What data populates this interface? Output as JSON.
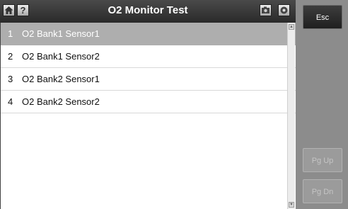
{
  "header": {
    "title": "O2 Monitor Test",
    "help_label": "?",
    "icons": [
      "home-icon",
      "help-icon",
      "camera-icon",
      "record-icon"
    ]
  },
  "list": {
    "items": [
      {
        "num": "1",
        "label": "O2 Bank1 Sensor1",
        "selected": true
      },
      {
        "num": "2",
        "label": "O2 Bank1 Sensor2",
        "selected": false
      },
      {
        "num": "3",
        "label": "O2 Bank2 Sensor1",
        "selected": false
      },
      {
        "num": "4",
        "label": "O2 Bank2 Sensor2",
        "selected": false
      }
    ]
  },
  "side": {
    "esc_label": "Esc",
    "pgup_label": "Pg Up",
    "pgdn_label": "Pg Dn"
  }
}
